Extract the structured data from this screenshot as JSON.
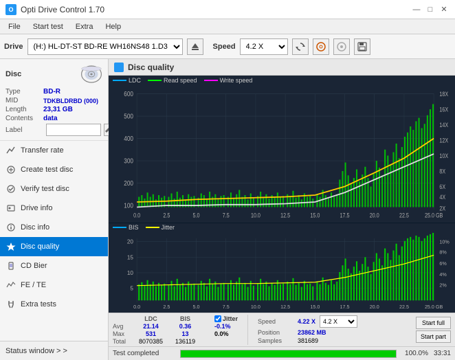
{
  "app": {
    "title": "Opti Drive Control 1.70",
    "icon": "O"
  },
  "titlebar": {
    "minimize": "—",
    "maximize": "□",
    "close": "✕"
  },
  "menubar": {
    "items": [
      "File",
      "Start test",
      "Extra",
      "Help"
    ]
  },
  "toolbar": {
    "drive_label": "Drive",
    "drive_value": "(H:)  HL-DT-ST BD-RE  WH16NS48 1.D3",
    "speed_label": "Speed",
    "speed_value": "4.2 X"
  },
  "disc": {
    "section_title": "Disc",
    "type_label": "Type",
    "type_value": "BD-R",
    "mid_label": "MID",
    "mid_value": "TDKBLDRBD (000)",
    "length_label": "Length",
    "length_value": "23,31 GB",
    "contents_label": "Contents",
    "contents_value": "data",
    "label_label": "Label",
    "label_value": ""
  },
  "nav": {
    "items": [
      {
        "id": "transfer-rate",
        "label": "Transfer rate",
        "icon": "📈"
      },
      {
        "id": "create-test-disc",
        "label": "Create test disc",
        "icon": "💿"
      },
      {
        "id": "verify-test-disc",
        "label": "Verify test disc",
        "icon": "✓"
      },
      {
        "id": "drive-info",
        "label": "Drive info",
        "icon": "ℹ"
      },
      {
        "id": "disc-info",
        "label": "Disc info",
        "icon": "💽"
      },
      {
        "id": "disc-quality",
        "label": "Disc quality",
        "icon": "★",
        "active": true
      },
      {
        "id": "cd-bier",
        "label": "CD Bier",
        "icon": "🍺"
      },
      {
        "id": "fe-te",
        "label": "FE / TE",
        "icon": "📊"
      },
      {
        "id": "extra-tests",
        "label": "Extra tests",
        "icon": "🔬"
      }
    ]
  },
  "status_window": {
    "label": "Status window > >"
  },
  "chart": {
    "title": "Disc quality",
    "top_legend": {
      "ldc": "LDC",
      "read": "Read speed",
      "write": "Write speed"
    },
    "bottom_legend": {
      "bis": "BIS",
      "jitter": "Jitter"
    },
    "top_y_left": [
      "600",
      "500",
      "400",
      "300",
      "200",
      "100"
    ],
    "top_y_right": [
      "18X",
      "16X",
      "14X",
      "12X",
      "10X",
      "8X",
      "6X",
      "4X",
      "2X"
    ],
    "bottom_y_left": [
      "20",
      "15",
      "10",
      "5"
    ],
    "bottom_y_right": [
      "10%",
      "8%",
      "6%",
      "4%",
      "2%"
    ],
    "x_labels": [
      "0.0",
      "2.5",
      "5.0",
      "7.5",
      "10.0",
      "12.5",
      "15.0",
      "17.5",
      "20.0",
      "22.5",
      "25.0 GB"
    ]
  },
  "stats": {
    "col_headers": [
      "LDC",
      "BIS",
      "",
      "Jitter",
      "Speed"
    ],
    "avg_label": "Avg",
    "avg_ldc": "21.14",
    "avg_bis": "0.36",
    "avg_jitter": "-0.1%",
    "max_label": "Max",
    "max_ldc": "531",
    "max_bis": "13",
    "max_jitter": "0.0%",
    "total_label": "Total",
    "total_ldc": "8070385",
    "total_bis": "136119",
    "speed_label": "Speed",
    "speed_value": "4.22 X",
    "position_label": "Position",
    "position_value": "23862 MB",
    "samples_label": "Samples",
    "samples_value": "381689",
    "jitter_checked": true,
    "speed_select": "4.2 X",
    "start_full": "Start full",
    "start_part": "Start part"
  },
  "progress": {
    "status_text": "Test completed",
    "percent": "100.0%",
    "time": "33:31",
    "fill_width": "100"
  }
}
